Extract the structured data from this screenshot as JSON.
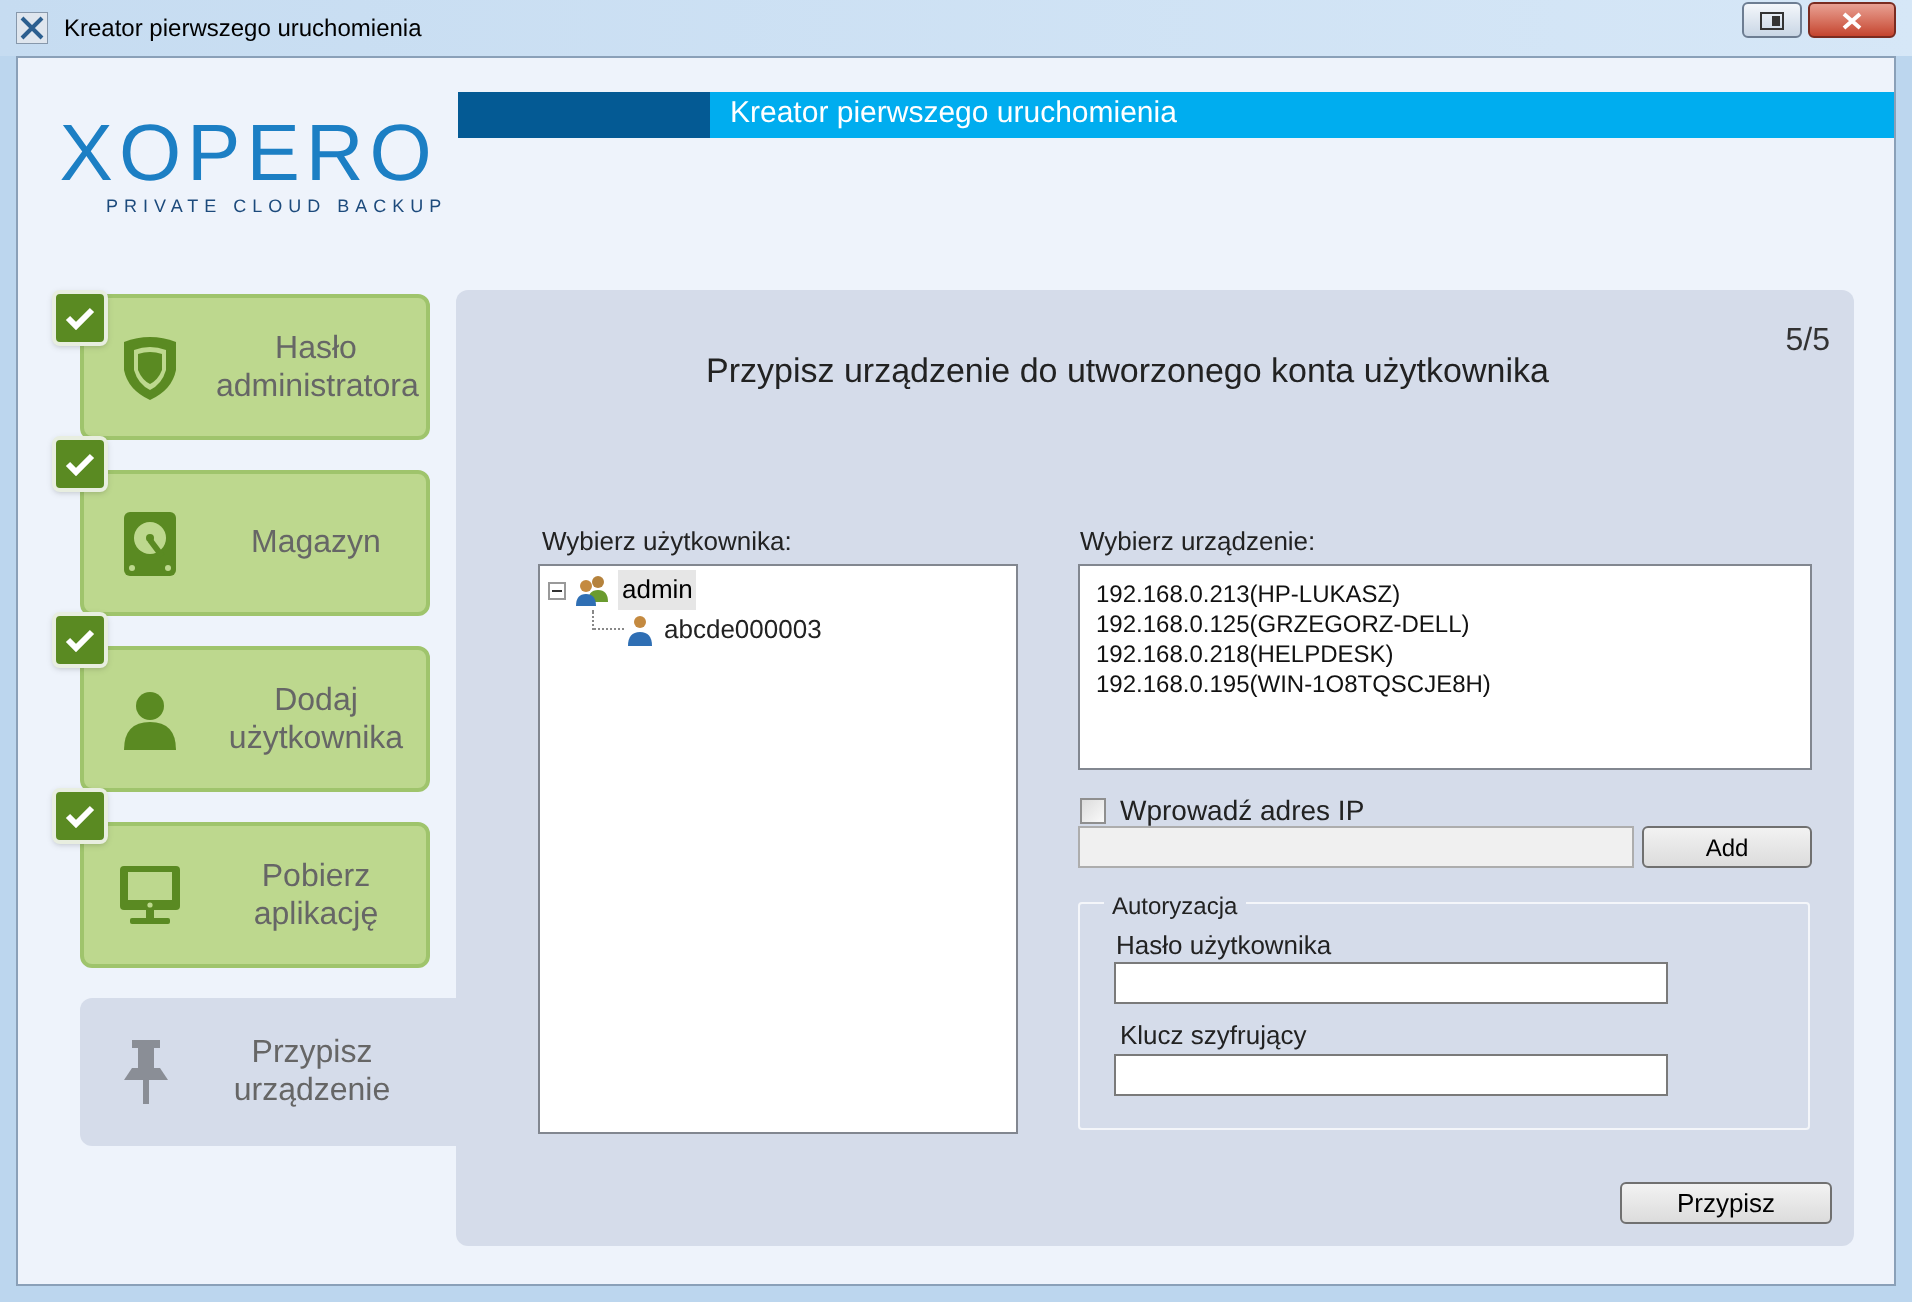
{
  "window": {
    "title": "Kreator pierwszego uruchomienia"
  },
  "logo": {
    "name": "XOPERO",
    "tagline": "PRIVATE CLOUD BACKUP"
  },
  "header": {
    "title": "Kreator pierwszego uruchomienia"
  },
  "steps": [
    {
      "label": "Hasło administratora",
      "kind": "shield",
      "completed": true,
      "selected": false
    },
    {
      "label": "Magazyn",
      "kind": "disk",
      "completed": true,
      "selected": false
    },
    {
      "label": "Dodaj użytkownika",
      "kind": "user",
      "completed": true,
      "selected": false
    },
    {
      "label": "Pobierz aplikację",
      "kind": "monitor",
      "completed": true,
      "selected": false
    },
    {
      "label": "Przypisz urządzenie",
      "kind": "pin",
      "completed": false,
      "selected": true
    }
  ],
  "panel": {
    "step": "5/5",
    "heading": "Przypisz urządzenie do utworzonego konta użytkownika",
    "users_label": "Wybierz użytkownika:",
    "users": [
      {
        "label": "admin",
        "kind": "group",
        "selected": true,
        "expanded": true,
        "children": [
          {
            "label": "abcde000003",
            "kind": "user",
            "selected": false
          }
        ]
      }
    ],
    "devices_label": "Wybierz urządzenie:",
    "devices": [
      {
        "label": "192.168.0.213(HP-LUKASZ)",
        "selected": false
      },
      {
        "label": "192.168.0.125(GRZEGORZ-DELL)",
        "selected": false
      },
      {
        "label": "192.168.0.218(HELPDESK)",
        "selected": false
      },
      {
        "label": "192.168.0.195(WIN-1O8TQSCJE8H)",
        "selected": false
      }
    ],
    "manual_ip": {
      "label": "Wprowadź adres IP",
      "checked": false
    },
    "add_button": "Add",
    "auth": {
      "legend": "Autoryzacja",
      "password_label": "Hasło użytkownika",
      "key_label": "Klucz szyfrujący"
    },
    "submit_button": "Przypisz"
  }
}
